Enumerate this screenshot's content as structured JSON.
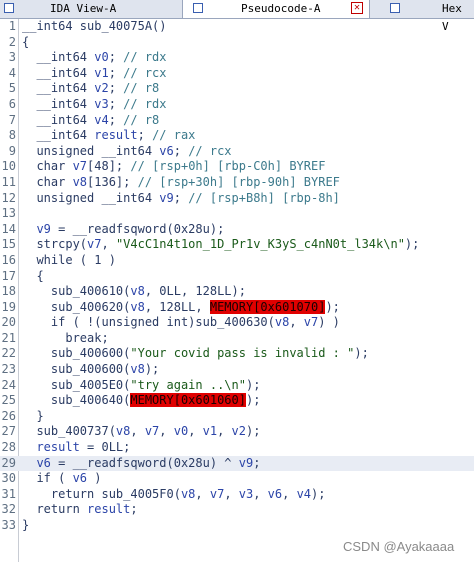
{
  "tabs": [
    {
      "label": "IDA View-A",
      "active": false
    },
    {
      "label": "Pseudocode-A",
      "active": true
    },
    {
      "label": "Hex V",
      "active": false
    }
  ],
  "watermark": "CSDN @Ayakaaaa",
  "lines": [
    {
      "n": "1",
      "t": "__int64 sub_40075A()"
    },
    {
      "n": "2",
      "t": "{"
    },
    {
      "n": "3",
      "t": "  __int64 v0; // rdx"
    },
    {
      "n": "4",
      "t": "  __int64 v1; // rcx"
    },
    {
      "n": "5",
      "t": "  __int64 v2; // r8"
    },
    {
      "n": "6",
      "t": "  __int64 v3; // rdx"
    },
    {
      "n": "7",
      "t": "  __int64 v4; // r8"
    },
    {
      "n": "8",
      "t": "  __int64 result; // rax"
    },
    {
      "n": "9",
      "t": "  unsigned __int64 v6; // rcx"
    },
    {
      "n": "10",
      "t": "  char v7[48]; // [rsp+0h] [rbp-C0h] BYREF"
    },
    {
      "n": "11",
      "t": "  char v8[136]; // [rsp+30h] [rbp-90h] BYREF"
    },
    {
      "n": "12",
      "t": "  unsigned __int64 v9; // [rsp+B8h] [rbp-8h]"
    },
    {
      "n": "13",
      "t": ""
    },
    {
      "n": "14",
      "t": "  v9 = __readfsqword(0x28u);"
    },
    {
      "n": "15",
      "t": "  strcpy(v7, \"V4cC1n4t1on_1D_Pr1v_K3yS_c4nN0t_l34k\\n\");"
    },
    {
      "n": "16",
      "t": "  while ( 1 )"
    },
    {
      "n": "17",
      "t": "  {"
    },
    {
      "n": "18",
      "t": "    sub_400610(v8, 0LL, 128LL);"
    },
    {
      "n": "19",
      "t": "    sub_400620(v8, 128LL, MEMORY[0x601070]);"
    },
    {
      "n": "20",
      "t": "    if ( !(unsigned int)sub_400630(v8, v7) )"
    },
    {
      "n": "21",
      "t": "      break;"
    },
    {
      "n": "22",
      "t": "    sub_400600(\"Your covid pass is invalid : \");"
    },
    {
      "n": "23",
      "t": "    sub_400600(v8);"
    },
    {
      "n": "24",
      "t": "    sub_4005E0(\"try again ..\\n\");"
    },
    {
      "n": "25",
      "t": "    sub_400640(MEMORY[0x601060]);"
    },
    {
      "n": "26",
      "t": "  }"
    },
    {
      "n": "27",
      "t": "  sub_400737(v8, v7, v0, v1, v2);"
    },
    {
      "n": "28",
      "t": "  result = 0LL;"
    },
    {
      "n": "29",
      "t": "  v6 = __readfsqword(0x28u) ^ v9;"
    },
    {
      "n": "30",
      "t": "  if ( v6 )"
    },
    {
      "n": "31",
      "t": "    return sub_4005F0(v8, v7, v3, v6, v4);"
    },
    {
      "n": "32",
      "t": "  return result;"
    },
    {
      "n": "33",
      "t": "}"
    }
  ],
  "highlighted_line": "29",
  "memory_tokens": [
    "MEMORY[0x601070]",
    "MEMORY[0x601060]"
  ]
}
